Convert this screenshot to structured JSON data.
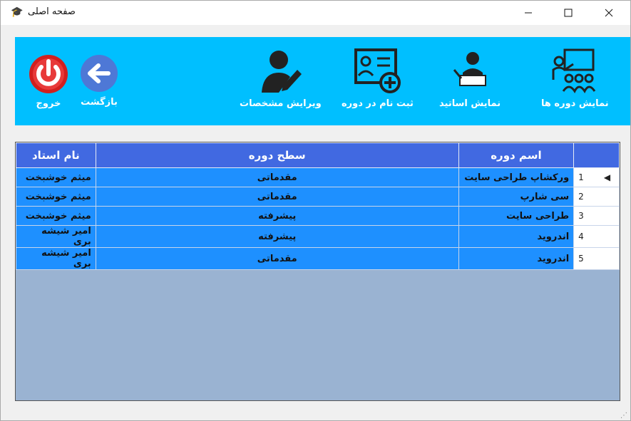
{
  "window": {
    "title": "صفحه اصلی"
  },
  "toolbar": {
    "items": [
      {
        "label": "نمایش دوره ها",
        "icon": "classroom-icon"
      },
      {
        "label": "نمایش اساتید",
        "icon": "teacher-icon"
      },
      {
        "label": "ثبت نام در دوره",
        "icon": "register-card-icon"
      },
      {
        "label": "ویرایش مشخصات",
        "icon": "edit-user-icon"
      },
      {
        "label": "بازگشت",
        "icon": "back-arrow-icon"
      },
      {
        "label": "خروج",
        "icon": "power-icon"
      }
    ]
  },
  "grid": {
    "columns": [
      "اسم دوره",
      "سطح دوره",
      "نام استاد"
    ],
    "rows": [
      {
        "num": "1",
        "name": "ورکشاپ طراحی سایت",
        "level": "مقدماتی",
        "teacher": "میثم خوشبخت"
      },
      {
        "num": "2",
        "name": "سی شارپ",
        "level": "مقدماتی",
        "teacher": "میثم خوشبخت"
      },
      {
        "num": "3",
        "name": "طراحی سایت",
        "level": "پیشرفته",
        "teacher": "میثم خوشبخت"
      },
      {
        "num": "4",
        "name": "اندروید",
        "level": "پیشرفته",
        "teacher": "امیر شیشه بری"
      },
      {
        "num": "5",
        "name": "اندروید",
        "level": "مقدماتی",
        "teacher": "امیر شیشه بری"
      }
    ]
  },
  "colors": {
    "toolbar": "#00bfff",
    "header": "#4169e1",
    "row": "#1e90ff",
    "grid_bg": "#9ab3d2"
  }
}
